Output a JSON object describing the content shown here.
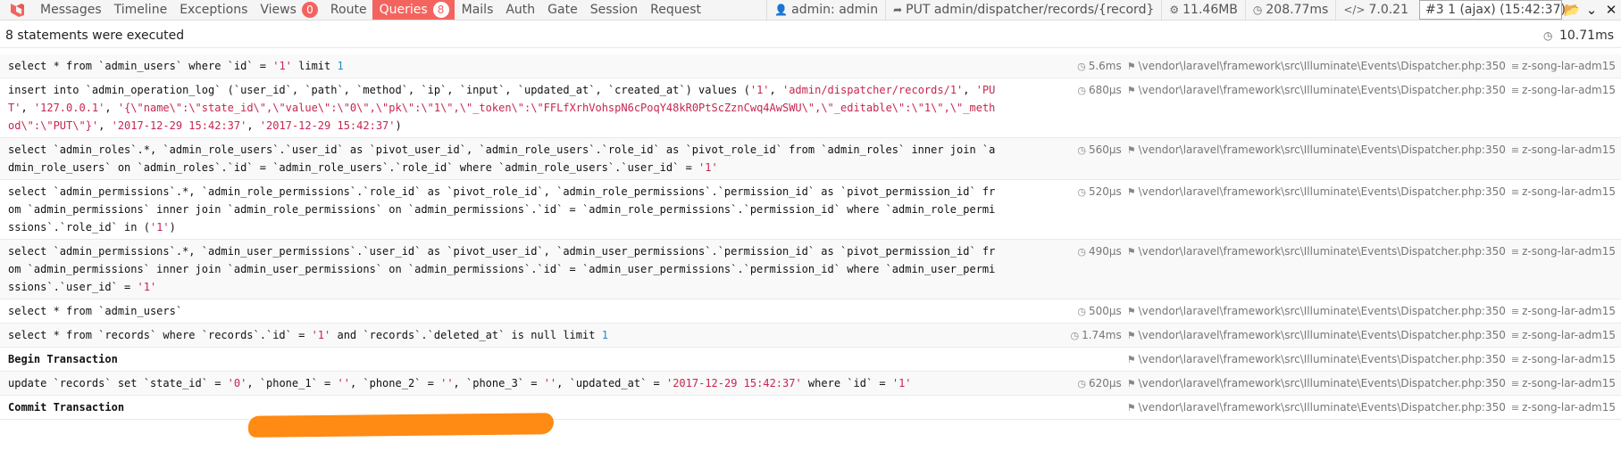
{
  "toolbar": {
    "tabs": [
      {
        "label": "Messages",
        "badge": null,
        "active": false
      },
      {
        "label": "Timeline",
        "badge": null,
        "active": false
      },
      {
        "label": "Exceptions",
        "badge": null,
        "active": false
      },
      {
        "label": "Views",
        "badge": "0",
        "active": false
      },
      {
        "label": "Route",
        "badge": null,
        "active": false
      },
      {
        "label": "Queries",
        "badge": "8",
        "active": true
      },
      {
        "label": "Mails",
        "badge": null,
        "active": false
      },
      {
        "label": "Auth",
        "badge": null,
        "active": false
      },
      {
        "label": "Gate",
        "badge": null,
        "active": false
      },
      {
        "label": "Session",
        "badge": null,
        "active": false
      },
      {
        "label": "Request",
        "badge": null,
        "active": false
      }
    ],
    "user": "admin: admin",
    "route": "PUT admin/dispatcher/records/{record}",
    "memory": "11.46MB",
    "time": "208.77ms",
    "version": "7.0.21",
    "request_select": "#3 1 (ajax) (15:42:37)",
    "accent_color": "#f4645f"
  },
  "summary": {
    "statements_text": "8 statements were executed",
    "total_time": "10.71ms"
  },
  "statements": [
    {
      "sql": "select * from `admin_users` where `id` = '1' limit 1",
      "duration": "5.6ms",
      "source": "\\vendor\\laravel\\framework\\src\\Illuminate\\Events\\Dispatcher.php:350",
      "connection": "z-song-lar-adm15",
      "bold": false
    },
    {
      "sql": "insert into `admin_operation_log` (`user_id`, `path`, `method`, `ip`, `input`, `updated_at`, `created_at`) values ('1', 'admin/dispatcher/records/1', 'PUT', '127.0.0.1', '{\\\"name\\\":\\\"state_id\\\",\\\"value\\\":\\\"0\\\",\\\"pk\\\":\\\"1\\\",\\\"_token\\\":\\\"FFLfXrhVohspN6cPoqY48kR0PtScZznCwq4AwSWU\\\",\\\"_editable\\\":\\\"1\\\",\\\"_method\\\":\\\"PUT\\\"}', '2017-12-29 15:42:37', '2017-12-29 15:42:37')",
      "duration": "680μs",
      "source": "\\vendor\\laravel\\framework\\src\\Illuminate\\Events\\Dispatcher.php:350",
      "connection": "z-song-lar-adm15",
      "bold": false
    },
    {
      "sql": "select `admin_roles`.*, `admin_role_users`.`user_id` as `pivot_user_id`, `admin_role_users`.`role_id` as `pivot_role_id` from `admin_roles` inner join `admin_role_users` on `admin_roles`.`id` = `admin_role_users`.`role_id` where `admin_role_users`.`user_id` = '1'",
      "duration": "560μs",
      "source": "\\vendor\\laravel\\framework\\src\\Illuminate\\Events\\Dispatcher.php:350",
      "connection": "z-song-lar-adm15",
      "bold": false
    },
    {
      "sql": "select `admin_permissions`.*, `admin_role_permissions`.`role_id` as `pivot_role_id`, `admin_role_permissions`.`permission_id` as `pivot_permission_id` from `admin_permissions` inner join `admin_role_permissions` on `admin_permissions`.`id` = `admin_role_permissions`.`permission_id` where `admin_role_permissions`.`role_id` in ('1')",
      "duration": "520μs",
      "source": "\\vendor\\laravel\\framework\\src\\Illuminate\\Events\\Dispatcher.php:350",
      "connection": "z-song-lar-adm15",
      "bold": false
    },
    {
      "sql": "select `admin_permissions`.*, `admin_user_permissions`.`user_id` as `pivot_user_id`, `admin_user_permissions`.`permission_id` as `pivot_permission_id` from `admin_permissions` inner join `admin_user_permissions` on `admin_permissions`.`id` = `admin_user_permissions`.`permission_id` where `admin_user_permissions`.`user_id` = '1'",
      "duration": "490μs",
      "source": "\\vendor\\laravel\\framework\\src\\Illuminate\\Events\\Dispatcher.php:350",
      "connection": "z-song-lar-adm15",
      "bold": false
    },
    {
      "sql": "select * from `admin_users`",
      "duration": "500μs",
      "source": "\\vendor\\laravel\\framework\\src\\Illuminate\\Events\\Dispatcher.php:350",
      "connection": "z-song-lar-adm15",
      "bold": false
    },
    {
      "sql": "select * from `records` where `records`.`id` = '1' and `records`.`deleted_at` is null limit 1",
      "duration": "1.74ms",
      "source": "\\vendor\\laravel\\framework\\src\\Illuminate\\Events\\Dispatcher.php:350",
      "connection": "z-song-lar-adm15",
      "bold": false
    },
    {
      "sql": "Begin Transaction",
      "duration": "",
      "source": "\\vendor\\laravel\\framework\\src\\Illuminate\\Events\\Dispatcher.php:350",
      "connection": "z-song-lar-adm15",
      "bold": true
    },
    {
      "sql": "update `records` set `state_id` = '0', `phone_1` = '', `phone_2` = '', `phone_3` = '', `updated_at` = '2017-12-29 15:42:37' where `id` = '1'",
      "duration": "620μs",
      "source": "\\vendor\\laravel\\framework\\src\\Illuminate\\Events\\Dispatcher.php:350",
      "connection": "z-song-lar-adm15",
      "bold": false
    },
    {
      "sql": "Commit Transaction",
      "duration": "",
      "source": "\\vendor\\laravel\\framework\\src\\Illuminate\\Events\\Dispatcher.php:350",
      "connection": "z-song-lar-adm15",
      "bold": true
    }
  ]
}
